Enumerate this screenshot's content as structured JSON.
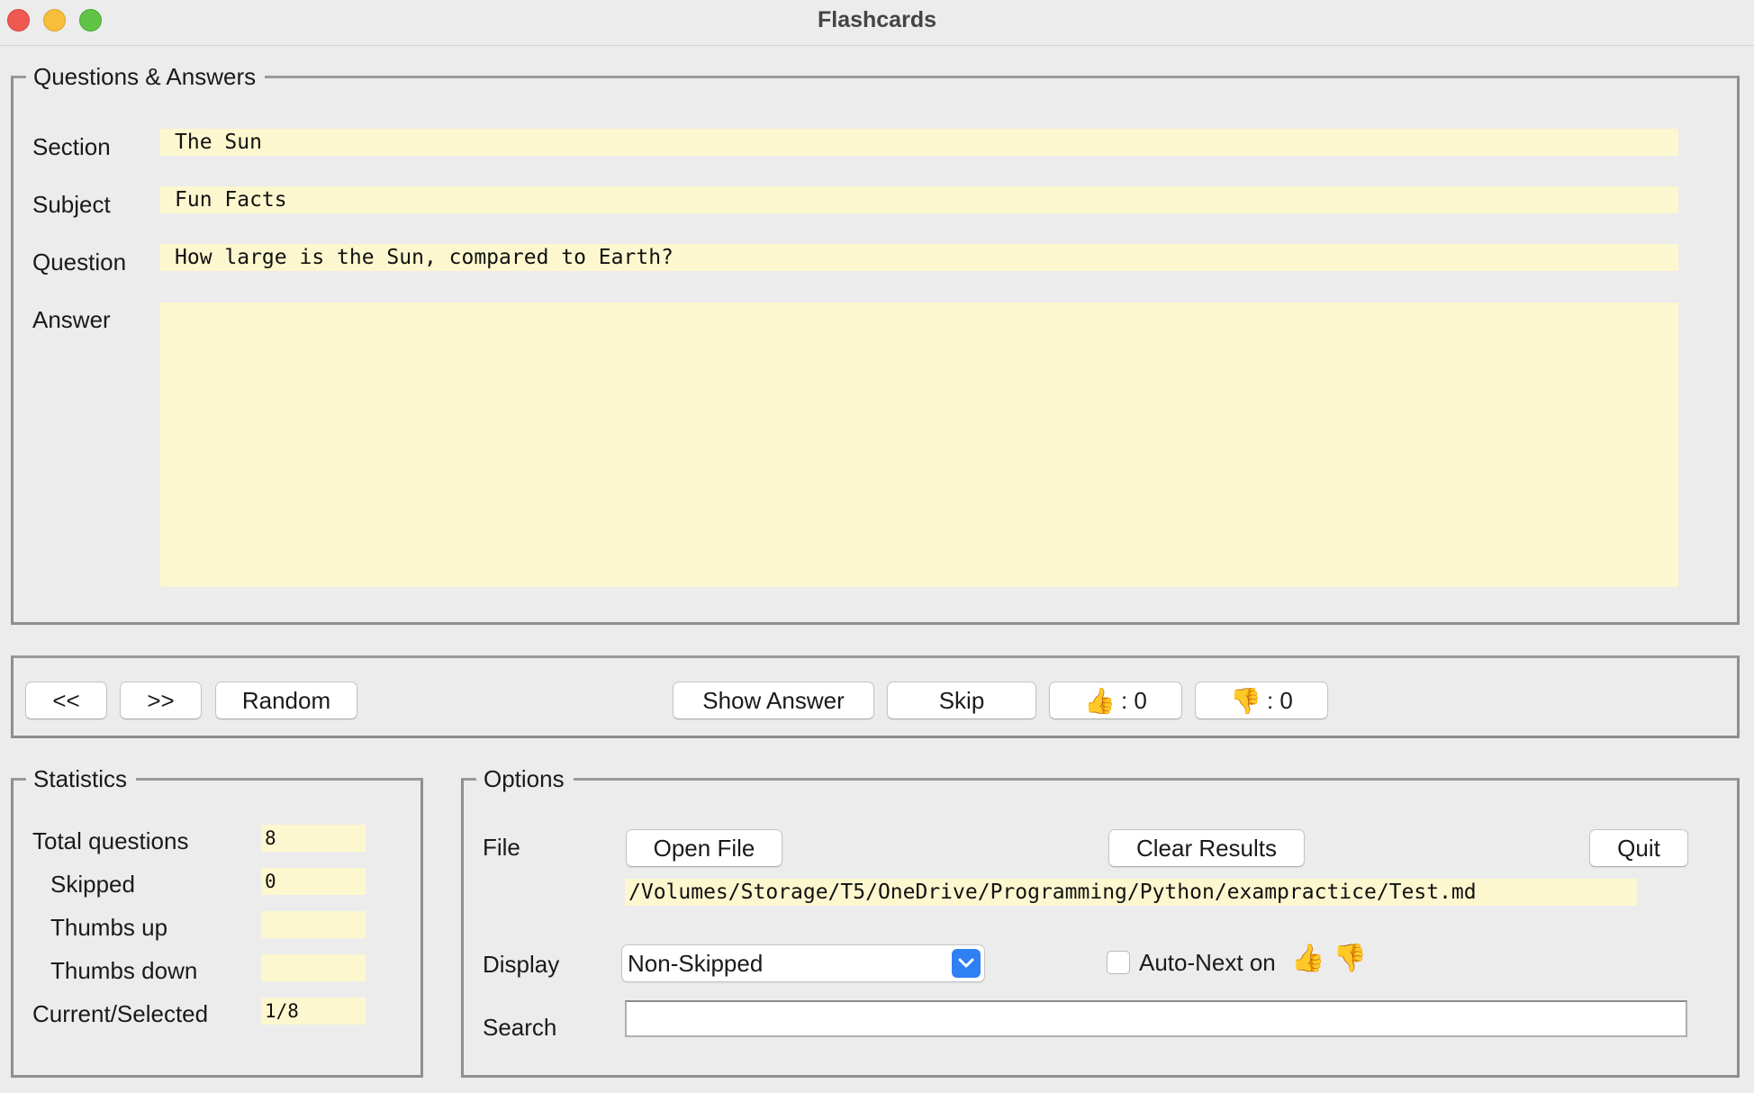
{
  "window": {
    "title": "Flashcards"
  },
  "qa": {
    "group_label": "Questions & Answers",
    "section_label": "Section",
    "section_value": "The Sun",
    "subject_label": "Subject",
    "subject_value": "Fun Facts",
    "question_label": "Question",
    "question_value": "How large is the Sun, compared to Earth?",
    "answer_label": "Answer",
    "answer_value": ""
  },
  "nav": {
    "prev_label": "<<",
    "next_label": ">>",
    "random_label": "Random",
    "show_answer_label": "Show Answer",
    "skip_label": "Skip",
    "thumbs_up_emoji": "👍",
    "thumbs_up_count": ": 0",
    "thumbs_down_emoji": "👎",
    "thumbs_down_count": ": 0"
  },
  "statistics": {
    "group_label": "Statistics",
    "total_label": "Total questions",
    "total_value": "8",
    "skipped_label": "Skipped",
    "skipped_value": "0",
    "thumbs_up_label": "Thumbs up",
    "thumbs_up_value": "",
    "thumbs_down_label": "Thumbs down",
    "thumbs_down_value": "",
    "current_label": "Current/Selected",
    "current_value": "1/8"
  },
  "options": {
    "group_label": "Options",
    "file_label": "File",
    "open_file_label": "Open File",
    "clear_results_label": "Clear Results",
    "quit_label": "Quit",
    "file_path": "/Volumes/Storage/T5/OneDrive/Programming/Python/exampractice/Test.md",
    "display_label": "Display",
    "display_selected": "Non-Skipped",
    "auto_next_label": "Auto-Next on",
    "auto_next_emojis": "👍 👎",
    "search_label": "Search",
    "search_value": ""
  },
  "colors": {
    "field_bg": "#fdf7cf",
    "window_bg": "#ececec",
    "accent": "#2f7ff5"
  }
}
